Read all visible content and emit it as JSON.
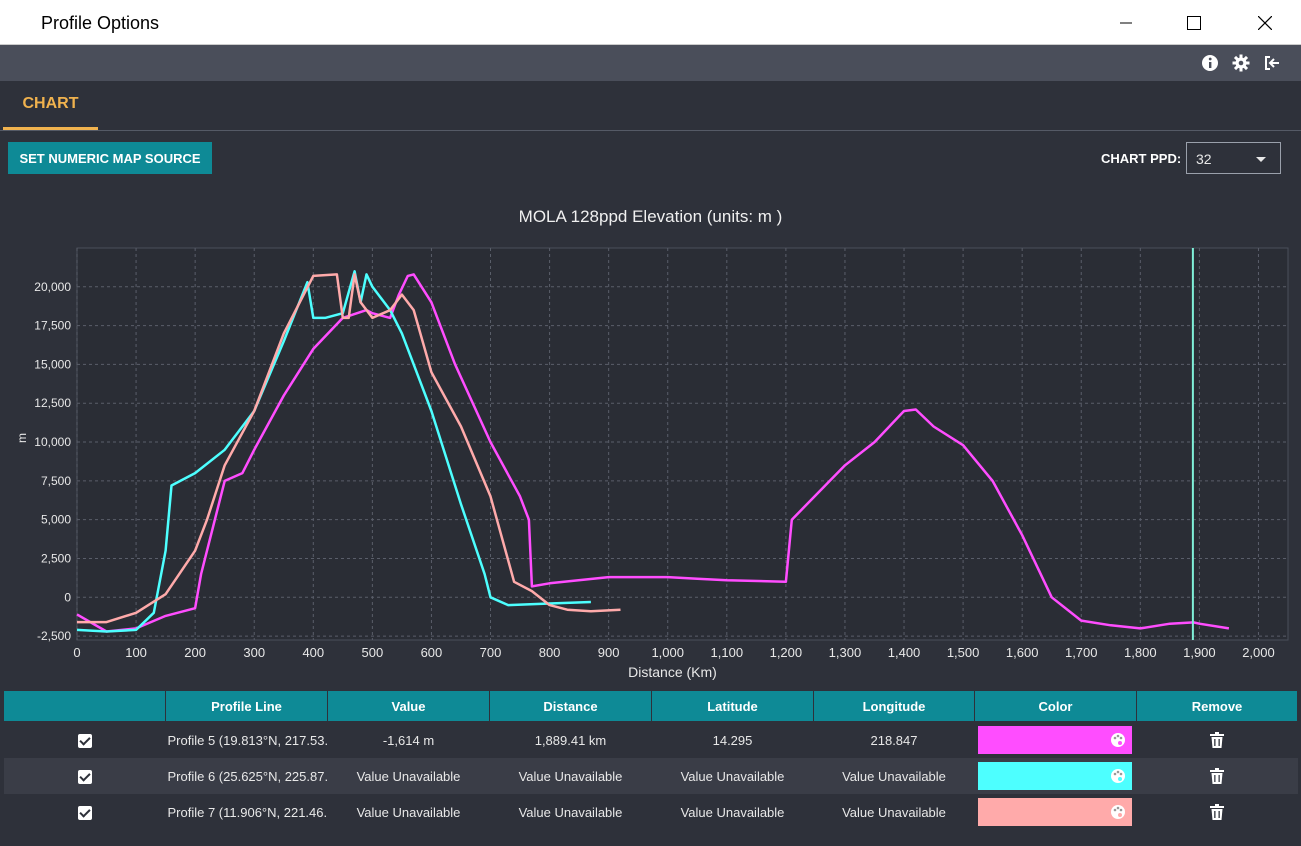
{
  "window": {
    "title": "Profile Options",
    "minimize_icon": "minimize-icon",
    "maximize_icon": "maximize-icon",
    "close_icon": "close-icon"
  },
  "toolbar": {
    "icons": [
      "info-icon",
      "gear-icon",
      "logout-icon"
    ]
  },
  "tabs": [
    {
      "label": "CHART",
      "active": true
    }
  ],
  "controls": {
    "set_source_label": "SET NUMERIC MAP SOURCE",
    "ppd_label": "CHART PPD:",
    "ppd_value": "32"
  },
  "chart_data": {
    "type": "line",
    "title": "MOLA 128ppd Elevation (units: m )",
    "xlabel": "Distance (Km)",
    "ylabel": "m",
    "xlim": [
      0,
      2000
    ],
    "ylim": [
      -2500,
      21000
    ],
    "x_ticks": [
      "0",
      "100",
      "200",
      "300",
      "400",
      "500",
      "600",
      "700",
      "800",
      "900",
      "1,000",
      "1,100",
      "1,200",
      "1,300",
      "1,400",
      "1,500",
      "1,600",
      "1,700",
      "1,800",
      "1,900",
      "2,000"
    ],
    "y_ticks": [
      "-2,500",
      "0",
      "2,500",
      "5,000",
      "7,500",
      "10,000",
      "12,500",
      "15,000",
      "17,500",
      "20,000"
    ],
    "grid": true,
    "cursor_x": 1889,
    "series": [
      {
        "color": "#ff4dff",
        "x": [
          0,
          50,
          100,
          150,
          200,
          210,
          220,
          250,
          280,
          300,
          350,
          400,
          450,
          490,
          500,
          530,
          545,
          560,
          570,
          600,
          640,
          700,
          750,
          765,
          770,
          800,
          900,
          1000,
          1050,
          1100,
          1200,
          1210,
          1300,
          1350,
          1400,
          1420,
          1450,
          1500,
          1550,
          1600,
          1650,
          1700,
          1750,
          1800,
          1850,
          1890,
          1900,
          1950
        ],
        "y": [
          -1100,
          -2200,
          -2000,
          -1200,
          -700,
          1500,
          3000,
          7500,
          8000,
          9500,
          13000,
          16000,
          18000,
          18500,
          18300,
          18000,
          19500,
          20700,
          20800,
          19000,
          15000,
          10000,
          6500,
          5000,
          700,
          900,
          1300,
          1300,
          1200,
          1100,
          1000,
          5000,
          8500,
          10000,
          12000,
          12100,
          11000,
          9800,
          7500,
          4000,
          0,
          -1500,
          -1800,
          -2000,
          -1700,
          -1614,
          -1700,
          -2000
        ]
      },
      {
        "color": "#4dffff",
        "x": [
          0,
          50,
          100,
          130,
          150,
          160,
          200,
          250,
          300,
          350,
          390,
          400,
          410,
          420,
          450,
          470,
          480,
          490,
          500,
          530,
          550,
          600,
          650,
          690,
          700,
          730,
          800,
          870
        ],
        "y": [
          -2100,
          -2200,
          -2100,
          -1000,
          3000,
          7200,
          8000,
          9500,
          12000,
          16500,
          20300,
          18000,
          18000,
          18000,
          18300,
          21000,
          19000,
          20800,
          20000,
          18500,
          17000,
          12000,
          6000,
          1500,
          0,
          -500,
          -400,
          -300
        ]
      },
      {
        "color": "#ffaaaa",
        "x": [
          0,
          50,
          100,
          150,
          200,
          220,
          250,
          300,
          350,
          400,
          440,
          450,
          460,
          470,
          480,
          500,
          530,
          550,
          570,
          600,
          650,
          700,
          740,
          770,
          800,
          830,
          870,
          920
        ],
        "y": [
          -1600,
          -1600,
          -1000,
          200,
          3000,
          5000,
          8500,
          12000,
          17000,
          20700,
          20800,
          18000,
          18000,
          20800,
          19000,
          18000,
          18500,
          19500,
          18500,
          14500,
          11000,
          6500,
          1000,
          400,
          -500,
          -800,
          -900,
          -800
        ]
      }
    ]
  },
  "table": {
    "headers": [
      "",
      "Profile Line",
      "Value",
      "Distance",
      "Latitude",
      "Longitude",
      "Color",
      "Remove"
    ],
    "rows": [
      {
        "checked": true,
        "profile": "Profile 5 (19.813°N, 217.53.",
        "value": "-1,614 m",
        "distance": "1,889.41 km",
        "latitude": "14.295",
        "longitude": "218.847",
        "color": "#ff4dff"
      },
      {
        "checked": true,
        "profile": "Profile 6 (25.625°N, 225.87.",
        "value": "Value Unavailable",
        "distance": "Value Unavailable",
        "latitude": "Value Unavailable",
        "longitude": "Value Unavailable",
        "color": "#4dffff"
      },
      {
        "checked": true,
        "profile": "Profile 7 (11.906°N, 221.46.",
        "value": "Value Unavailable",
        "distance": "Value Unavailable",
        "latitude": "Value Unavailable",
        "longitude": "Value Unavailable",
        "color": "#ffaaaa"
      }
    ]
  }
}
